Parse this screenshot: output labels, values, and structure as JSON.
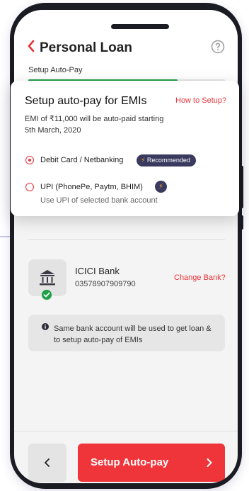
{
  "colors": {
    "accent": "#e8343a",
    "primary_button": "#f0353a",
    "progress": "#1ea048",
    "badge_bg": "#393a5e",
    "bolt": "#f5a623"
  },
  "header": {
    "title": "Personal Loan",
    "back_icon": "chevron-left-icon",
    "help_icon": "question-circle-icon",
    "step_label": "Setup Auto-Pay",
    "progress_percent": 76
  },
  "dialog": {
    "title": "Setup auto-pay for EMIs",
    "help_link": "How to Setup?",
    "description": "EMI of ₹11,000 will be auto-paid starting 5th March, 2020",
    "options": [
      {
        "label": "Debit Card / Netbanking",
        "selected": true,
        "badge": "Recommended",
        "badge_icon": "lightning-icon"
      },
      {
        "label": "UPI (PhonePe, Paytm, BHIM)",
        "selected": false,
        "sublabel": "Use UPI of selected bank account",
        "badge_icon": "lightning-icon"
      }
    ]
  },
  "bank": {
    "icon": "bank-icon",
    "name": "ICICI Bank",
    "account_number": "03578907909790",
    "change_link": "Change Bank?"
  },
  "info": {
    "icon": "info-icon",
    "text": "Same bank account will be used to get loan & to setup auto-pay of EMIs"
  },
  "footer": {
    "back_icon": "chevron-left-icon",
    "primary_label": "Setup Auto-pay",
    "primary_icon": "chevron-right-icon"
  }
}
